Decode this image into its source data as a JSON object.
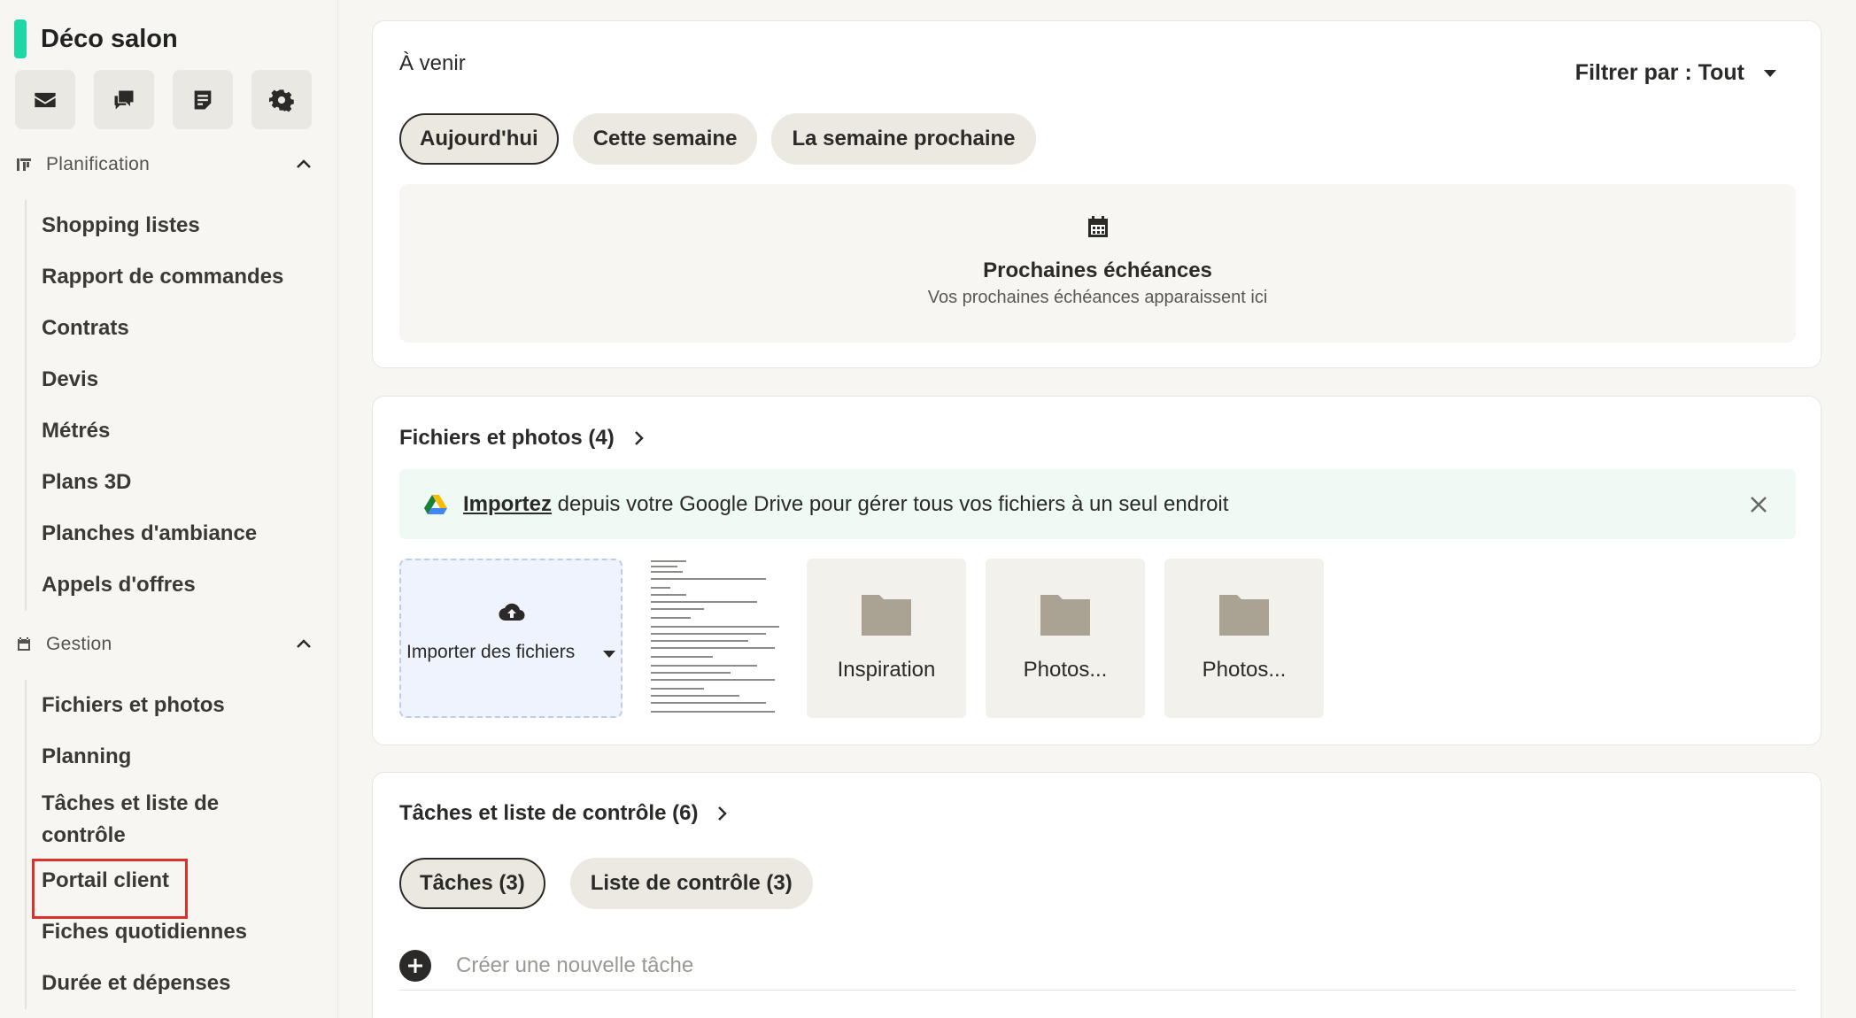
{
  "sidebar": {
    "project_name": "Déco salon",
    "quick_icons": [
      "mail-icon",
      "chat-icon",
      "notes-icon",
      "gear-icon"
    ],
    "sections": [
      {
        "label": "Planification",
        "items": [
          "Shopping listes",
          "Rapport de commandes",
          "Contrats",
          "Devis",
          "Métrés",
          "Plans 3D",
          "Planches d'ambiance",
          "Appels d'offres"
        ]
      },
      {
        "label": "Gestion",
        "items": [
          "Fichiers et photos",
          "Planning",
          "Tâches et liste de contrôle",
          "Portail client",
          "Fiches quotidiennes",
          "Durée et dépenses"
        ]
      }
    ],
    "highlighted_item": "Portail client"
  },
  "upcoming": {
    "title": "À venir",
    "filter_label": "Filtrer par : Tout",
    "pills": [
      "Aujourd'hui",
      "Cette semaine",
      "La semaine prochaine"
    ],
    "active_pill": "Aujourd'hui",
    "empty_title": "Prochaines échéances",
    "empty_subtitle": "Vos prochaines échéances apparaissent ici"
  },
  "files": {
    "title": "Fichiers et photos (4)",
    "banner_link": "Importez",
    "banner_text": " depuis votre Google Drive pour gérer tous vos fichiers à un seul endroit",
    "upload_label": "Importer des fichiers",
    "folders": [
      "Inspiration",
      "Photos...",
      "Photos..."
    ]
  },
  "tasks": {
    "title": "Tâches et liste de contrôle (6)",
    "pills": [
      "Tâches (3)",
      "Liste de contrôle (3)"
    ],
    "active_pill": "Tâches (3)",
    "new_task_placeholder": "Créer une nouvelle tâche"
  },
  "colors": {
    "accent": "#1ed6a6",
    "highlight_border": "#d9342b"
  }
}
